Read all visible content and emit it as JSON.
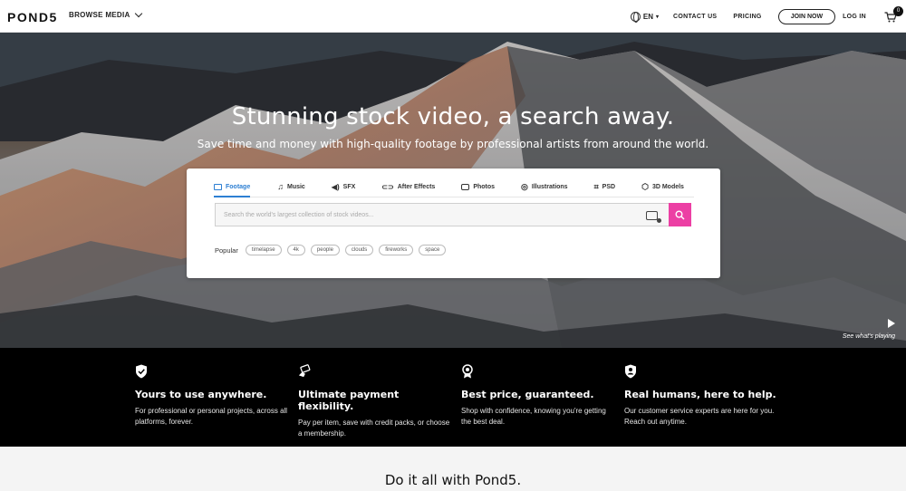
{
  "header": {
    "logo": "POND5",
    "browse_label": "BROWSE MEDIA",
    "lang_label": "EN",
    "contact_label": "CONTACT US",
    "pricing_label": "PRICING",
    "join_label": "JOIN NOW",
    "login_label": "LOG IN",
    "cart_count": "0"
  },
  "hero": {
    "title": "Stunning stock video, a search away.",
    "subtitle": "Save time and money with high-quality footage by professional artists from around the world.",
    "see_playing": "See what's playing"
  },
  "search": {
    "tabs": [
      {
        "label": "Footage",
        "icon": "video-icon"
      },
      {
        "label": "Music",
        "icon": "music-note-icon"
      },
      {
        "label": "SFX",
        "icon": "speaker-icon"
      },
      {
        "label": "After Effects",
        "icon": "ae-icon"
      },
      {
        "label": "Photos",
        "icon": "camera-icon"
      },
      {
        "label": "Illustrations",
        "icon": "illustration-icon"
      },
      {
        "label": "PSD",
        "icon": "crop-icon"
      },
      {
        "label": "3D Models",
        "icon": "cube-icon"
      }
    ],
    "active_tab": "Footage",
    "placeholder": "Search the world's largest collection of stock videos...",
    "popular_label": "Popular",
    "popular_terms": [
      "timelapse",
      "4k",
      "people",
      "clouds",
      "fireworks",
      "space"
    ]
  },
  "features": [
    {
      "icon": "shield-check-icon",
      "title": "Yours to use anywhere.",
      "text": "For professional or personal projects, across all platforms, forever."
    },
    {
      "icon": "card-hand-icon",
      "title": "Ultimate payment flexibility.",
      "text": "Pay per item, save with credit packs, or choose a membership."
    },
    {
      "icon": "award-ribbon-icon",
      "title": "Best price, guaranteed.",
      "text": "Shop with confidence, knowing you're getting the best deal."
    },
    {
      "icon": "person-icon",
      "title": "Real humans, here to help.",
      "text": "Our customer service experts are here for you. Reach out anytime."
    }
  ],
  "bottom": {
    "title": "Do it all with Pond5."
  },
  "colors": {
    "accent_pink": "#ec3fa4",
    "active_tab_blue": "#2d7fd3"
  }
}
